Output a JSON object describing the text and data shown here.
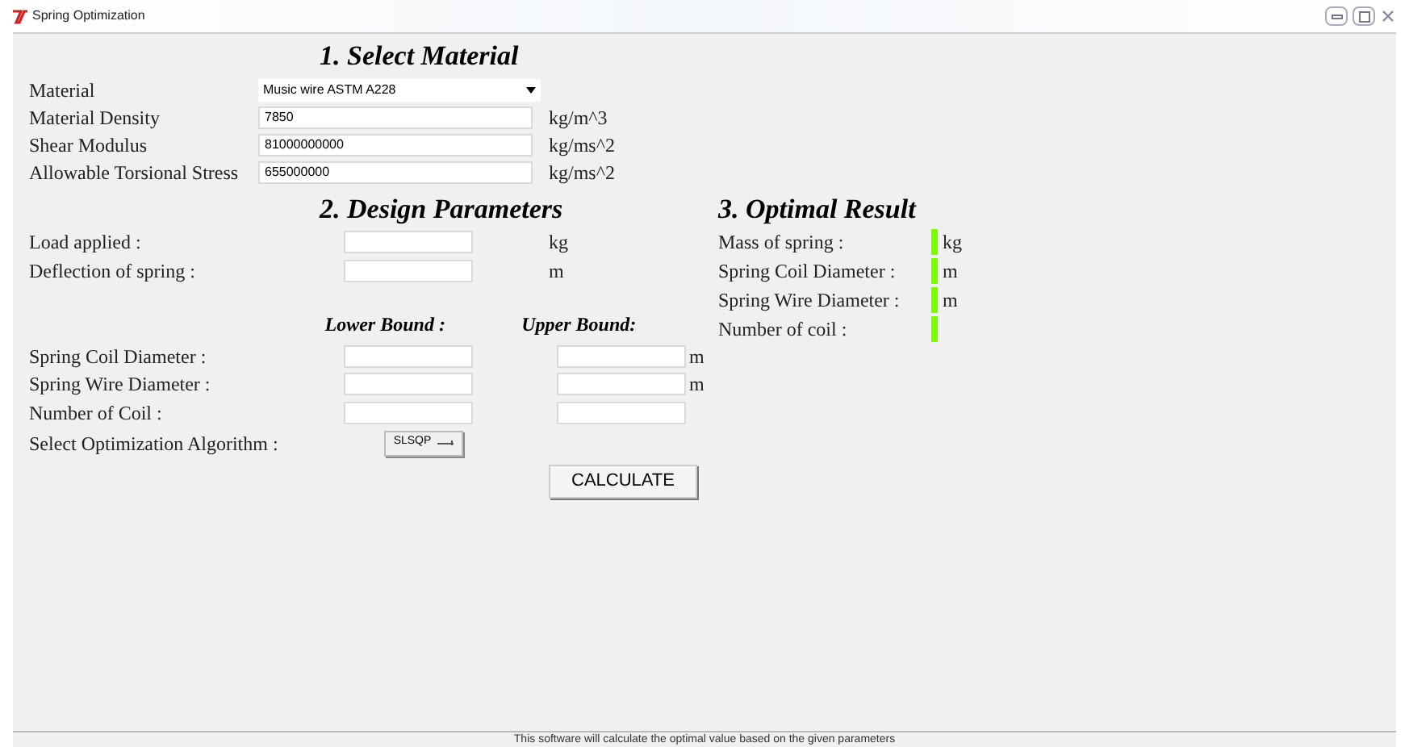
{
  "window": {
    "title": "Spring Optimization"
  },
  "material_section": {
    "heading": "1. Select Material",
    "rows": [
      {
        "kind": "dropdown",
        "label": "Material",
        "value": "Music wire ASTM A228"
      },
      {
        "kind": "field",
        "label": "Material Density",
        "value": "7850",
        "unit": "kg/m^3"
      },
      {
        "kind": "field",
        "label": "Shear Modulus",
        "value": "81000000000",
        "unit": "kg/ms^2"
      },
      {
        "kind": "field",
        "label": "Allowable Torsional Stress",
        "value": "655000000",
        "unit": "kg/ms^2"
      }
    ]
  },
  "design_section": {
    "heading": "2. Design Parameters",
    "inputs": [
      {
        "label": "Load applied :",
        "unit": "kg"
      },
      {
        "label": "Deflection of spring :",
        "unit": "m"
      }
    ],
    "bound_headers": [
      "Lower Bound :",
      "Upper Bound:"
    ],
    "bounds": [
      {
        "label": "Spring Coil Diameter :",
        "unit": "m"
      },
      {
        "label": "Spring Wire Diameter :",
        "unit": "m"
      },
      {
        "label": "Number of Coil :"
      }
    ],
    "algorithm": {
      "label": "Select Optimization Algorithm :",
      "value": "SLSQP"
    },
    "calculate_button": "CALCULATE"
  },
  "result_section": {
    "heading": "3. Optimal Result",
    "rows": [
      {
        "label": "Mass of spring :",
        "unit": "kg"
      },
      {
        "label": "Spring Coil Diameter :",
        "unit": "m"
      },
      {
        "label": "Spring Wire Diameter :",
        "unit": "m"
      },
      {
        "label": "Number of coil :"
      }
    ]
  },
  "status_bar": "This software will calculate the optimal value based on the given parameters"
}
